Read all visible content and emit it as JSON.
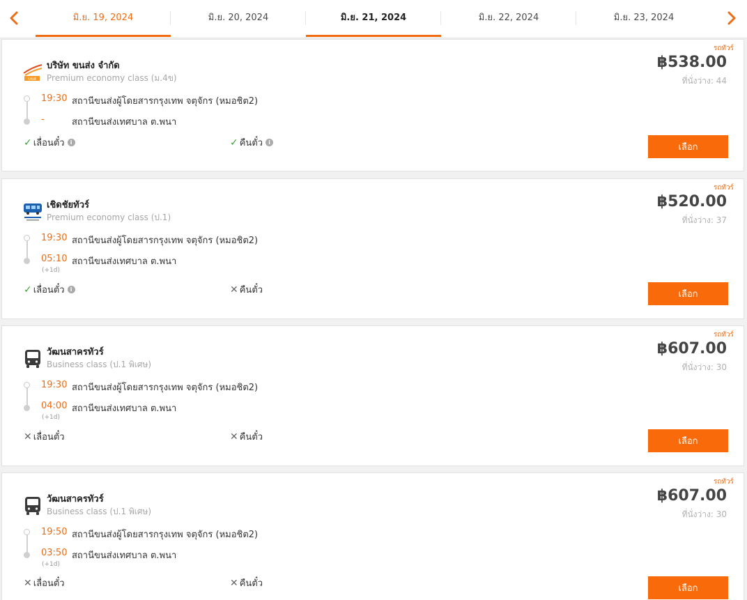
{
  "date_bar": {
    "tabs": [
      {
        "label": "มิ.ย. 19, 2024"
      },
      {
        "label": "มิ.ย. 20, 2024"
      },
      {
        "label": "มิ.ย. 21, 2024"
      },
      {
        "label": "มิ.ย. 22, 2024"
      },
      {
        "label": "มิ.ย. 23, 2024"
      }
    ],
    "selected_index": 2,
    "prev_icon": "chevron-left-icon",
    "next_icon": "chevron-right-icon"
  },
  "colors": {
    "accent": "#f06c12",
    "button": "#f86a0a",
    "ok": "#3aa33a"
  },
  "trips": [
    {
      "badge": "รถทัวร์",
      "operator": "บริษัท ขนส่ง จำกัด",
      "class": "Premium economy class (ม.4ข)",
      "price": "฿538.00",
      "seats": "ที่นั่งว่าง: 44",
      "dep_time": "19:30",
      "dep_station": "สถานีขนส่งผู้โดยสารกรุงเทพ จตุจักร (หมอชิต2)",
      "arr_time": "-",
      "arr_station": "สถานีขนส่งเทศบาล ต.พนา",
      "next_day": "",
      "policy1": "เลื่อนตั๋ว",
      "policy2": "คืนตั๋ว",
      "button": "เลือก"
    },
    {
      "badge": "รถทัวร์",
      "operator": "เชิดชัยทัวร์",
      "class": "Premium economy class (ป.1)",
      "price": "฿520.00",
      "seats": "ที่นั่งว่าง: 37",
      "dep_time": "19:30",
      "dep_station": "สถานีขนส่งผู้โดยสารกรุงเทพ จตุจักร (หมอชิต2)",
      "arr_time": "05:10",
      "arr_station": "สถานีขนส่งเทศบาล ต.พนา",
      "next_day": "(+1d)",
      "policy1": "เลื่อนตั๋ว",
      "policy2": "คืนตั๋ว",
      "button": "เลือก"
    },
    {
      "badge": "รถทัวร์",
      "operator": "วัฒนสาครทัวร์",
      "class": "Business class (ป.1 พิเศษ)",
      "price": "฿607.00",
      "seats": "ที่นั่งว่าง: 30",
      "dep_time": "19:30",
      "dep_station": "สถานีขนส่งผู้โดยสารกรุงเทพ จตุจักร (หมอชิต2)",
      "arr_time": "04:00",
      "arr_station": "สถานีขนส่งเทศบาล ต.พนา",
      "next_day": "(+1d)",
      "policy1": "เลื่อนตั๋ว",
      "policy2": "คืนตั๋ว",
      "button": "เลือก"
    },
    {
      "badge": "รถทัวร์",
      "operator": "วัฒนสาครทัวร์",
      "class": "Business class (ป.1 พิเศษ)",
      "price": "฿607.00",
      "seats": "ที่นั่งว่าง: 30",
      "dep_time": "19:50",
      "dep_station": "สถานีขนส่งผู้โดยสารกรุงเทพ จตุจักร (หมอชิต2)",
      "arr_time": "03:50",
      "arr_station": "สถานีขนส่งเทศบาล ต.พนา",
      "next_day": "(+1d)",
      "policy1": "เลื่อนตั๋ว",
      "policy2": "คืนตั๋ว",
      "button": "เลือก"
    }
  ]
}
